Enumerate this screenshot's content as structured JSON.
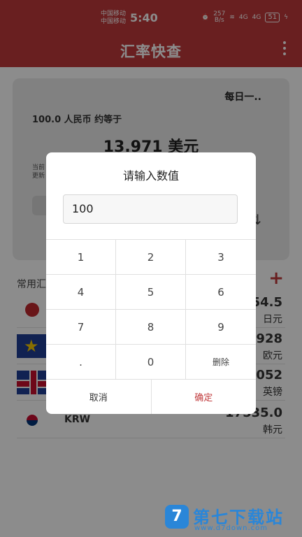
{
  "status_bar": {
    "carrier_1": "中国移动",
    "carrier_2": "中国移动",
    "time": "5:40",
    "net_speed": "257",
    "net_unit": "B/s",
    "signal_1": "4G",
    "signal_2": "4G",
    "battery": "51"
  },
  "app_bar": {
    "title": "汇率快查"
  },
  "card": {
    "tag": "每日一..",
    "source_line": "100.0 人民币 约等于",
    "result": "13.971 美元",
    "note_1": "当前",
    "note_2": "更新"
  },
  "list": {
    "header": "常用汇",
    "rows": [
      {
        "code": "",
        "rate": "54.5",
        "unit": "日元",
        "flag": "jp"
      },
      {
        "code": "",
        "rate": "928",
        "unit": "欧元",
        "flag": "eu"
      },
      {
        "code": "",
        "rate": "052",
        "unit": "英镑",
        "flag": "gb"
      },
      {
        "code": "KRW",
        "rate": "17535.0",
        "unit": "韩元",
        "flag": "kr"
      }
    ]
  },
  "dialog": {
    "title": "请输入数值",
    "input_value": "100",
    "keys": [
      "1",
      "2",
      "3",
      "4",
      "5",
      "6",
      "7",
      "8",
      "9",
      ".",
      "0",
      "删除"
    ],
    "cancel_label": "取消",
    "confirm_label": "确定"
  },
  "watermark": {
    "logo": "7",
    "text": "第七下载站",
    "url": "www.d7down.com"
  },
  "colors": {
    "brand": "#c0393b",
    "watermark": "#2a86d8"
  }
}
